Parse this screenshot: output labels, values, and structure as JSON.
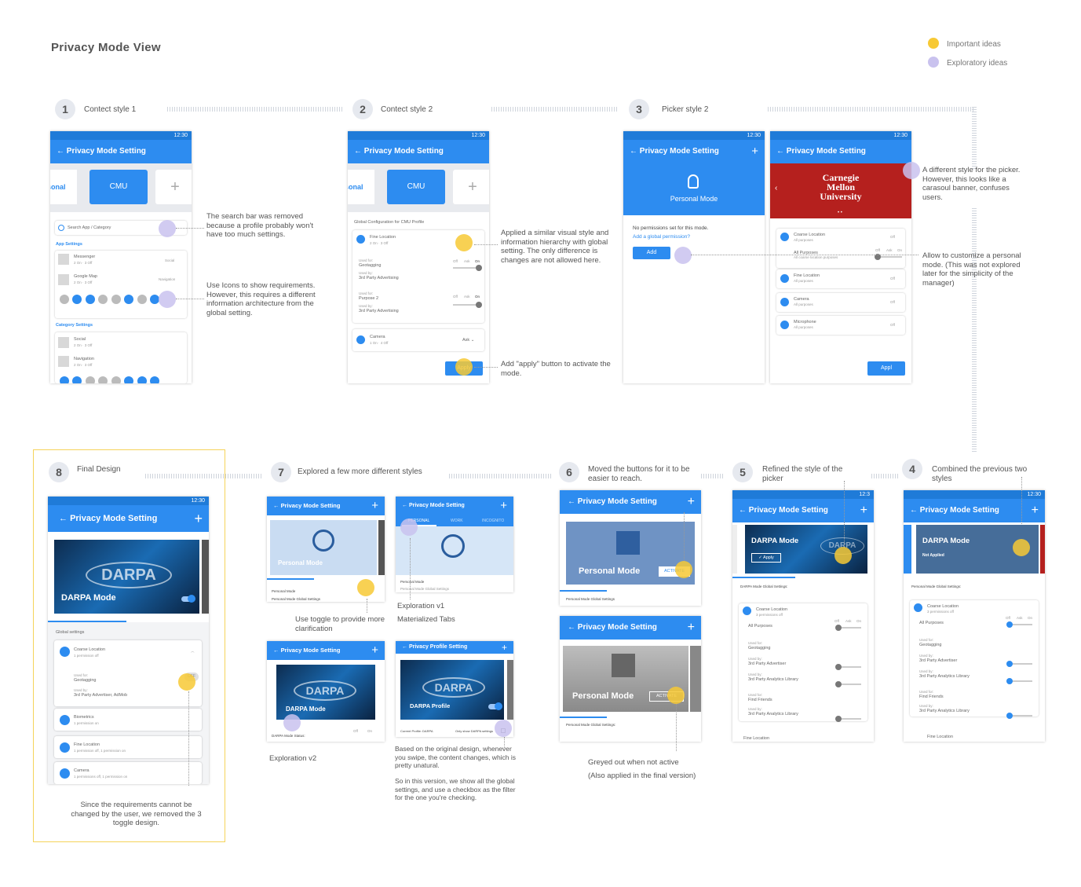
{
  "page_title": "Privacy Mode View",
  "legend": {
    "important": "Important ideas",
    "exploratory": "Exploratory ideas",
    "important_color": "#f7c935",
    "exploratory_color": "#c9c2ee"
  },
  "steps": {
    "s1": {
      "num": "1",
      "label": "Contect style 1"
    },
    "s2": {
      "num": "2",
      "label": "Contect style 2"
    },
    "s3": {
      "num": "3",
      "label": "Picker style 2"
    },
    "s4": {
      "num": "4",
      "label": "Combined the previous two styles"
    },
    "s5": {
      "num": "5",
      "label": "Refined the style of the picker"
    },
    "s6": {
      "num": "6",
      "label": "Moved the buttons for it to be easier to reach."
    },
    "s7": {
      "num": "7",
      "label": "Explored a few more different styles"
    },
    "s8": {
      "num": "8",
      "label": "Final Design"
    }
  },
  "notes": {
    "n1": "The search bar was removed because a profile probably won't have too much settings.",
    "n2": "Use Icons to show requirements. However, this requires a different information architecture from the global setting.",
    "n3": "Applied a similar visual style and information hierarchy with global setting. The only difference is changes are not allowed here.",
    "n4": "Add \"apply\" button to activate the mode.",
    "n5": "A different style for the picker. However, this looks like a carasoul banner, confuses users.",
    "n6": "Allow to customize a personal mode. (This was not explored later for the simplicity of the manager)",
    "n7": "Greyed out when not active",
    "n8": "(Also applied in the final version)",
    "n9": "Use toggle to provide more clarification",
    "n10": "Exploration v1",
    "n11": "Materialized Tabs",
    "n12": "Exploration v2",
    "n13": "Based on the original design, whenever you swipe, the content changes, which is pretty unatural.",
    "n14": "So in this version, we show all the global settings, and use a checkbox as the filter for the one you're checking.",
    "n15": "Since the requirements cannot be changed by the user, we removed the 3 toggle design."
  },
  "phone": {
    "time": "12:30",
    "time_cut": "12:3",
    "header": "Privacy Mode Setting",
    "header_profile": "Privacy Profile Setting",
    "back": "←",
    "plus": "+",
    "sonal": "sonal",
    "cmu": "CMU",
    "search": "Search App / Category",
    "app_settings": "App Settings",
    "messenger": "Messenger",
    "messenger_sub": "2 On · 3 Off",
    "social_badge": "Social",
    "google_map": "Google Map",
    "google_sub": "2 On · 3 Off",
    "nav_badge": "Navigation",
    "category_settings": "Category Settings",
    "social": "Social",
    "social_sub": "2 On · 3 Off",
    "navigation": "Navigation",
    "navigation_sub": "2 On · 3 Off",
    "global_config": "Global Configuration for CMU Profile",
    "fine_location": "Fine Location",
    "fine_sub": "2 On · 3 Off",
    "used_for": "Used for:",
    "geotagging": "Geotagging",
    "used_by": "Used by:",
    "third_party_adv": "3rd Party Advertising",
    "purpose2": "Purpose 2",
    "off": "Off",
    "ask": "Ask",
    "on": "On",
    "camera": "Camera",
    "camera_sub": "1 On · 4 Off",
    "apply": "Apply",
    "personal_mode": "Personal Mode",
    "no_perm": "No permissions set for this mode.",
    "add_global": "Add a global permission?",
    "add": "Add",
    "carnegie1": "Carnegie",
    "carnegie2": "Mellon",
    "carnegie3": "University",
    "coarse_location": "Coarse Location",
    "all_purposes": "All purposes",
    "all_purposes_cap": "All Purposes",
    "all_purposes_sub": "All coarse location purposes",
    "microphone": "Microphone",
    "appl": "Appl",
    "darpa_mode": "DARPA Mode",
    "apply_check": "✓ Apply",
    "not_applied": "Not Applied",
    "personal_global": "Personal Mode Global Settings:",
    "darpa_global": "DARPA Mode Global Settings:",
    "perm_off": "3 permissions off",
    "third_adv": "3rd Party Advertiser",
    "third_analytics": "3rd Party Analytics Library",
    "find_friends": "Find Friends",
    "activate": "ACTIVATE",
    "personal_mode_label": "Personal Mode",
    "personal_mode_global_short": "Personal Mode Global Settings",
    "tab_personal": "PERSONAL",
    "tab_work": "WORK",
    "tab_incognito": "INCOGNITO",
    "darpa": "DARPA",
    "darpa_mode_status": "DARPA Mode Status:",
    "darpa_profile": "DARPA Profile",
    "current_profile": "Current Profile: DARPA",
    "only_show": "Only show DARPA settings",
    "global_settings": "Global settings",
    "coarse_sub": "1 permission off",
    "adv_admob": "3rd Party Advertiser, AdMob",
    "biometrics": "Biometrics",
    "biometrics_sub": "1 permission on",
    "fine_sub2": "1 permission off, 1 permission on",
    "camera_sub2": "1 permissions off, 1 permission on",
    "off_badge": "OFF",
    "off_ask": "Off",
    "ask_caret": "Ask ⌄"
  }
}
